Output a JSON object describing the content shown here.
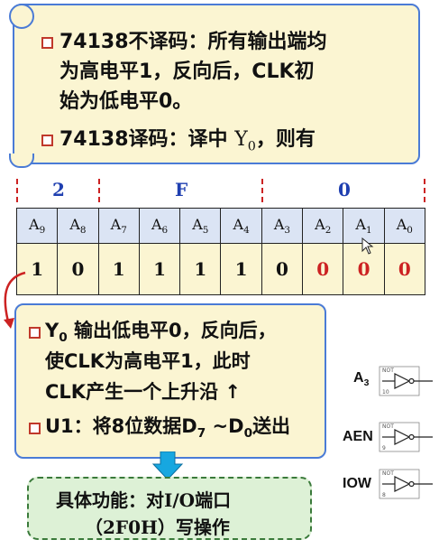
{
  "top_box": {
    "line1": "74138不译码：所有输出端均",
    "line2": "为高电平1，反向后，CLK初",
    "line3": "始为低电平0。",
    "line4_prefix": "74138译码：译中 ",
    "line4_y": "Y",
    "line4_sub": "0",
    "line4_suffix": "，则有"
  },
  "hex_digits": [
    "2",
    "F",
    "0"
  ],
  "address_bits": {
    "headers": [
      {
        "letter": "A",
        "sub": "9"
      },
      {
        "letter": "A",
        "sub": "8"
      },
      {
        "letter": "A",
        "sub": "7"
      },
      {
        "letter": "A",
        "sub": "6"
      },
      {
        "letter": "A",
        "sub": "5"
      },
      {
        "letter": "A",
        "sub": "4"
      },
      {
        "letter": "A",
        "sub": "3"
      },
      {
        "letter": "A",
        "sub": "2"
      },
      {
        "letter": "A",
        "sub": "1"
      },
      {
        "letter": "A",
        "sub": "0"
      }
    ],
    "values": [
      "1",
      "0",
      "1",
      "1",
      "1",
      "1",
      "0",
      "0",
      "0",
      "0"
    ],
    "red_value_indices": [
      7,
      8,
      9
    ],
    "value_color": "#111111",
    "red_color": "#cc2222"
  },
  "bottom_box": {
    "b1_y": "Y",
    "b1_sub": "0",
    "b1_rest": " 输出低电平0，反向后，",
    "b1_line2": "使CLK为高电平1，此时",
    "b1_line3": "CLK产生一个上升沿 ↑",
    "b2_prefix": "U1：将8位数据D",
    "b2_sub1": "7",
    "b2_mid": " ~D",
    "b2_sub2": "0",
    "b2_suffix": "送出"
  },
  "function_box": {
    "line1": "具体功能：对I/O端口",
    "line2": "（2F0H）写操作"
  },
  "gates": [
    {
      "label": "A",
      "sub": "3",
      "small_top": "NOT",
      "small_bottom": "10"
    },
    {
      "label": "AEN",
      "sub": "",
      "small_top": "NOT",
      "small_bottom": "9"
    },
    {
      "label": "IOW",
      "sub": "",
      "small_top": "NOT",
      "small_bottom": "8"
    }
  ],
  "colors": {
    "callout_fill": "#fbf5d2",
    "callout_border": "#4a7bd6",
    "header_fill": "#dbe4f4",
    "hex_color": "#1f3fb0",
    "function_fill": "#ddf1d6",
    "arrow_color": "#17a7e0"
  }
}
